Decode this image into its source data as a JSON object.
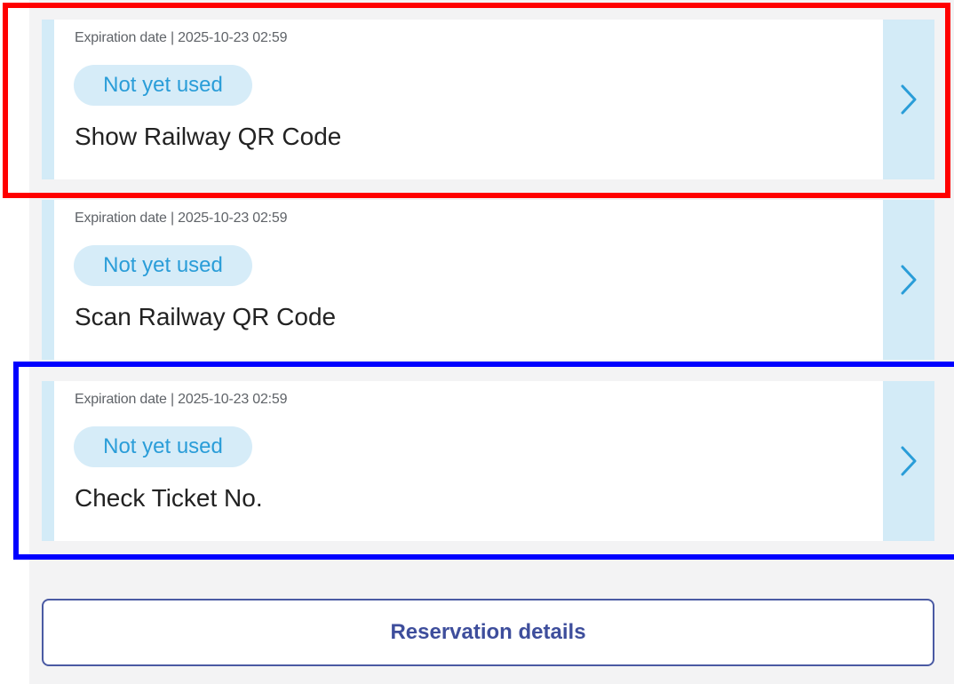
{
  "tickets": [
    {
      "expiration": "Expiration date | 2025-10-23 02:59",
      "status": "Not yet used",
      "title": "Show Railway QR Code"
    },
    {
      "expiration": "Expiration date | 2025-10-23 02:59",
      "status": "Not yet used",
      "title": "Scan Railway QR Code"
    },
    {
      "expiration": "Expiration date | 2025-10-23 02:59",
      "status": "Not yet used",
      "title": "Check Ticket No."
    }
  ],
  "icons": {
    "chevron": "chevron-right-icon"
  },
  "colors": {
    "accent_light": "#d3ebf7",
    "status_text": "#2a9dd8",
    "button_text": "#3e4e9c",
    "highlight_red": "#ff0000",
    "highlight_blue": "#0000ff"
  },
  "reservation_button": {
    "label": "Reservation details"
  }
}
